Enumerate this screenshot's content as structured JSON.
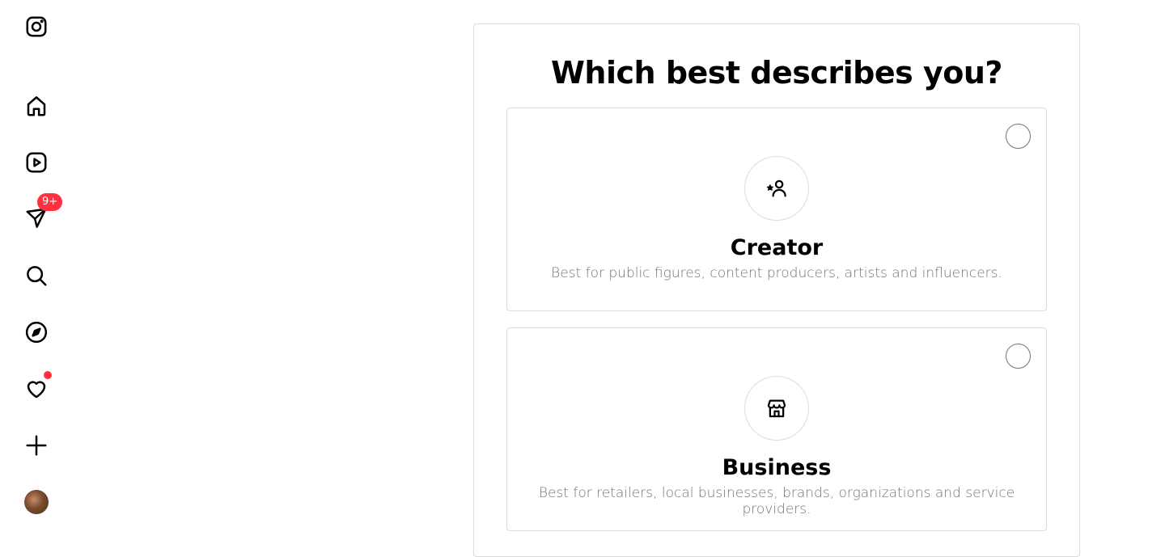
{
  "sidebar": {
    "items": [
      {
        "name": "instagram-logo-icon"
      },
      {
        "name": "home-icon"
      },
      {
        "name": "reels-icon"
      },
      {
        "name": "messages-icon",
        "badge": "9+"
      },
      {
        "name": "search-icon"
      },
      {
        "name": "explore-icon"
      },
      {
        "name": "notifications-heart-icon",
        "has_dot": true
      },
      {
        "name": "create-plus-icon"
      },
      {
        "name": "profile-avatar"
      }
    ],
    "badge_color": "#ff3040"
  },
  "main": {
    "title": "Which best describes you?",
    "options": [
      {
        "title": "Creator",
        "description": "Best for public figures, content producers, artists and influencers.",
        "icon": "creator-star-person-icon",
        "selected": false
      },
      {
        "title": "Business",
        "description": "Best for retailers, local businesses, brands, organizations and service providers.",
        "icon": "storefront-icon",
        "selected": false
      }
    ]
  }
}
